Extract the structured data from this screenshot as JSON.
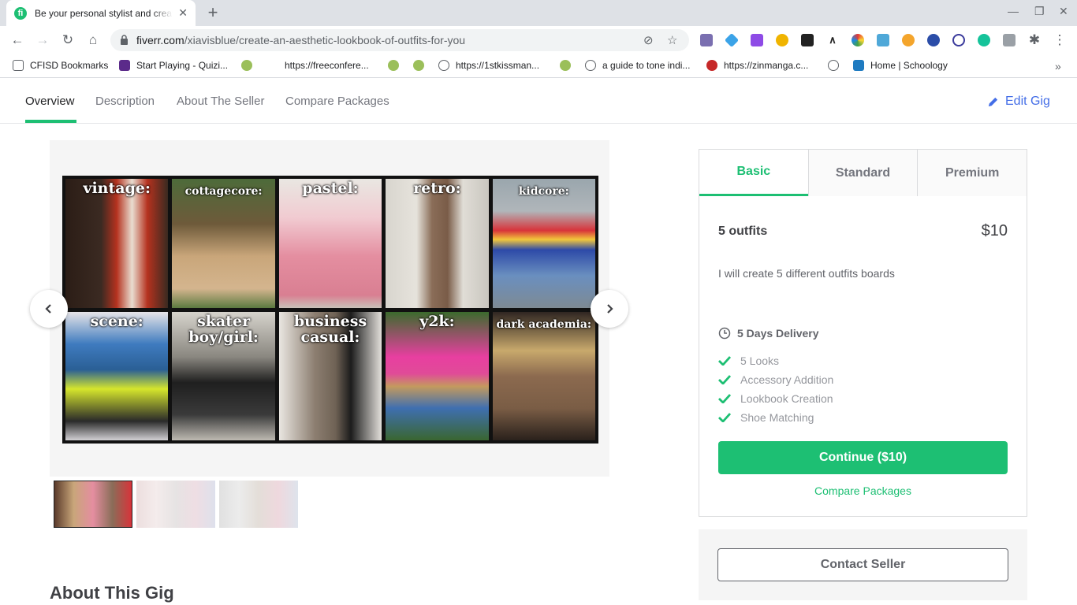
{
  "browser": {
    "tab_title": "Be your personal stylist and create",
    "url_host": "fiverr.com",
    "url_path": "/xiavisblue/create-an-aesthetic-lookbook-of-outfits-for-you"
  },
  "bookmarks": [
    {
      "label": "CFISD Bookmarks",
      "icon": "folder-icon"
    },
    {
      "label": "Start Playing - Quizi...",
      "icon": "quizizz-icon"
    },
    {
      "label": "",
      "icon": "frog-icon"
    },
    {
      "label": "https://freeconfere...",
      "icon": "frog-icon"
    },
    {
      "label": "",
      "icon": "frog-icon"
    },
    {
      "label": "https://1stkissman...",
      "icon": "globe-icon"
    },
    {
      "label": "",
      "icon": "frog-icon"
    },
    {
      "label": "a guide to tone indi...",
      "icon": "globe-icon"
    },
    {
      "label": "https://zinmanga.c...",
      "icon": "zinmanga-icon"
    },
    {
      "label": "",
      "icon": "globe-icon"
    },
    {
      "label": "Home | Schoology",
      "icon": "schoology-icon"
    }
  ],
  "page_nav": {
    "items": [
      "Overview",
      "Description",
      "About The Seller",
      "Compare Packages"
    ],
    "edit_gig": "Edit Gig"
  },
  "gallery": {
    "labels": [
      "vintage:",
      "cottagecore:",
      "pastel:",
      "retro:",
      "kidcore:",
      "scene:",
      "skater boy/girl:",
      "business casual:",
      "y2k:",
      "dark academia:"
    ]
  },
  "about_heading": "About This Gig",
  "package": {
    "tabs": [
      "Basic",
      "Standard",
      "Premium"
    ],
    "name": "5 outfits",
    "price": "$10",
    "description": "I will create 5 different outfits boards",
    "delivery": "5 Days Delivery",
    "features": [
      "5 Looks",
      "Accessory Addition",
      "Lookbook Creation",
      "Shoe Matching"
    ],
    "continue_label": "Continue ($10)",
    "compare_label": "Compare Packages"
  },
  "contact_label": "Contact Seller",
  "colors": {
    "brand_green": "#1dbf73",
    "edit_blue": "#446ee7"
  }
}
